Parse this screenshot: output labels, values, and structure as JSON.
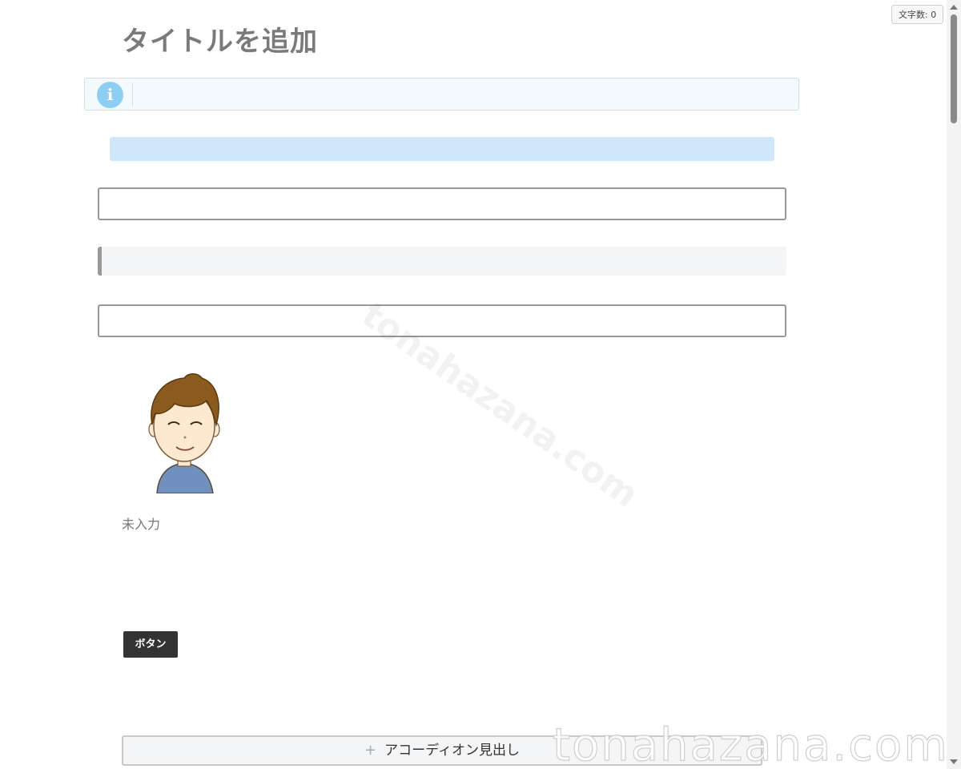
{
  "toolbar": {
    "wordcount_label": "文字数: 0"
  },
  "editor": {
    "title_placeholder": "タイトルを追加",
    "info_icon": "info-icon",
    "avatar_name": "未入力",
    "button_label": "ボタン",
    "accordion_label": "アコーディオン見出し",
    "accordion_icon": "plus-icon"
  },
  "watermarks": {
    "center": "tonahazana.com",
    "bottom": "tonahazana.com"
  },
  "colors": {
    "info_bg": "#f2fafd",
    "info_icon": "#8ccff3",
    "highlight": "#cfe6fb",
    "button_bg": "#333333",
    "border": "#999999"
  }
}
